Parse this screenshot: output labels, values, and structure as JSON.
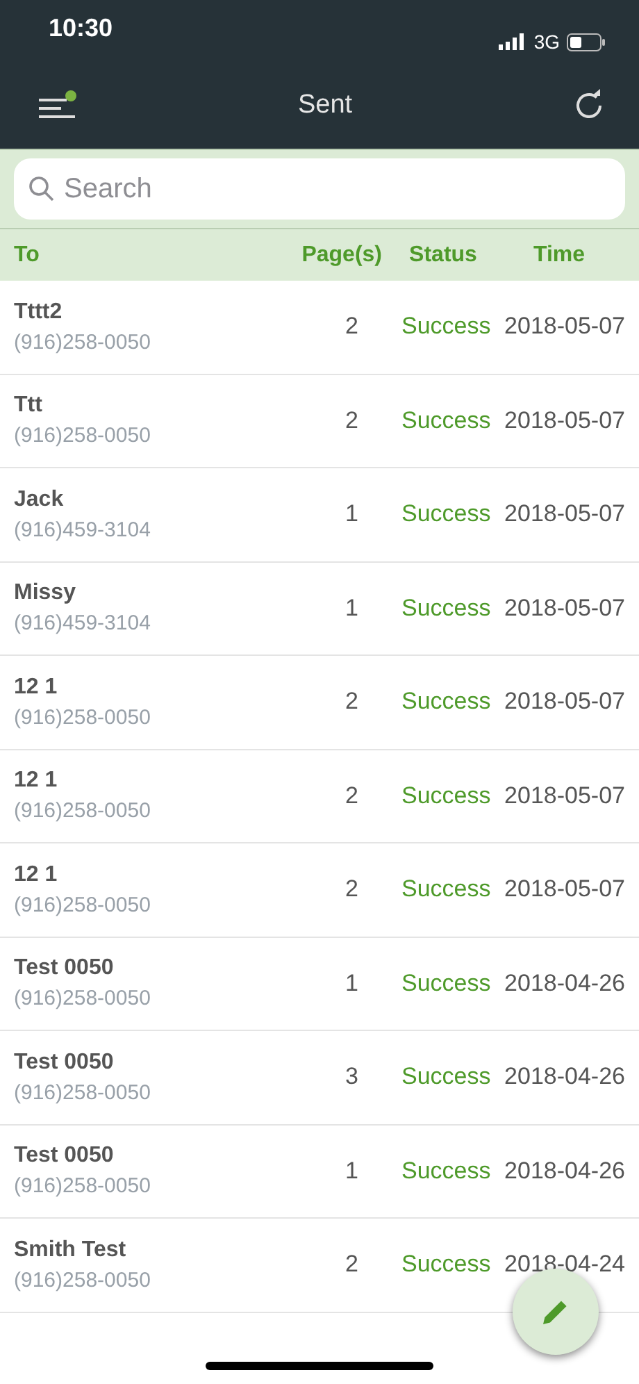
{
  "status_bar": {
    "time": "10:30",
    "network": "3G"
  },
  "nav": {
    "title": "Sent",
    "menu_badge": true
  },
  "search": {
    "placeholder": "Search"
  },
  "table": {
    "columns": [
      "To",
      "Page(s)",
      "Status",
      "Time"
    ],
    "rows": [
      {
        "name": "Tttt2",
        "phone": "(916)258-0050",
        "pages": "2",
        "status": "Success",
        "time": "2018-05-07"
      },
      {
        "name": "Ttt",
        "phone": "(916)258-0050",
        "pages": "2",
        "status": "Success",
        "time": "2018-05-07"
      },
      {
        "name": "Jack",
        "phone": "(916)459-3104",
        "pages": "1",
        "status": "Success",
        "time": "2018-05-07"
      },
      {
        "name": "Missy",
        "phone": "(916)459-3104",
        "pages": "1",
        "status": "Success",
        "time": "2018-05-07"
      },
      {
        "name": "12 1",
        "phone": "(916)258-0050",
        "pages": "2",
        "status": "Success",
        "time": "2018-05-07"
      },
      {
        "name": "12 1",
        "phone": "(916)258-0050",
        "pages": "2",
        "status": "Success",
        "time": "2018-05-07"
      },
      {
        "name": "12 1",
        "phone": "(916)258-0050",
        "pages": "2",
        "status": "Success",
        "time": "2018-05-07"
      },
      {
        "name": "Test 0050",
        "phone": "(916)258-0050",
        "pages": "1",
        "status": "Success",
        "time": "2018-04-26"
      },
      {
        "name": "Test 0050",
        "phone": "(916)258-0050",
        "pages": "3",
        "status": "Success",
        "time": "2018-04-26"
      },
      {
        "name": "Test 0050",
        "phone": "(916)258-0050",
        "pages": "1",
        "status": "Success",
        "time": "2018-04-26"
      },
      {
        "name": "Smith Test",
        "phone": "(916)258-0050",
        "pages": "2",
        "status": "Success",
        "time": "2018-04-24"
      }
    ]
  }
}
